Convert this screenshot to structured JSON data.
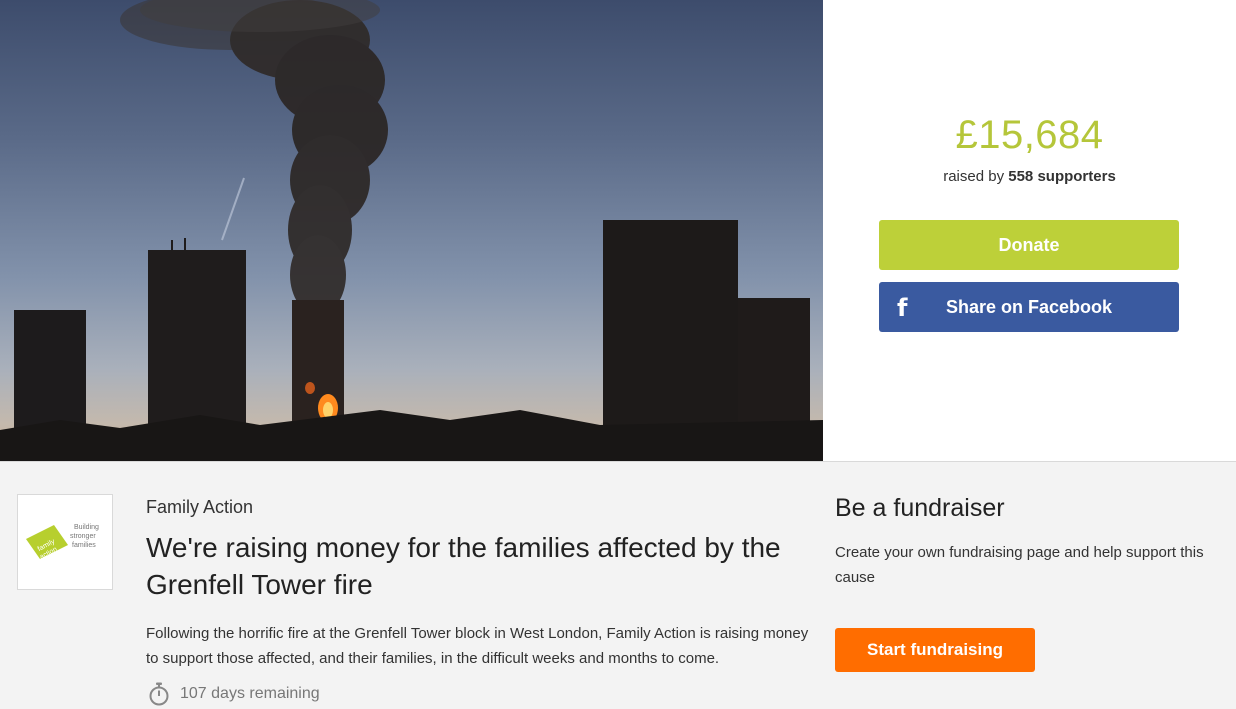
{
  "hero": {
    "image_description_icon": "tower-fire-photo"
  },
  "donate_panel": {
    "amount": "£15,684",
    "raised_prefix": "raised by ",
    "supporters": "558 supporters",
    "donate_label": "Donate",
    "facebook_label": "Share on Facebook",
    "facebook_icon": "f"
  },
  "campaign": {
    "charity_name": "Family Action",
    "logo_text_1": "family",
    "logo_text_2": "action",
    "logo_tagline": [
      "Building",
      "stronger",
      "families"
    ],
    "headline": "We're raising money for the families affected by the Grenfell Tower fire",
    "description": "Following the horrific fire at the Grenfell Tower block in West London, Family Action is raising money to support those affected, and their families, in the difficult weeks and months to come.",
    "days_remaining": "107 days remaining"
  },
  "fundraiser": {
    "title": "Be a fundraiser",
    "text": "Create your own fundraising page and help support this cause",
    "button_label": "Start fundraising"
  },
  "colors": {
    "accent_green": "#bdd039",
    "amount_green": "#b5c63a",
    "facebook_blue": "#3a5aa0",
    "orange": "#ff6d00"
  }
}
